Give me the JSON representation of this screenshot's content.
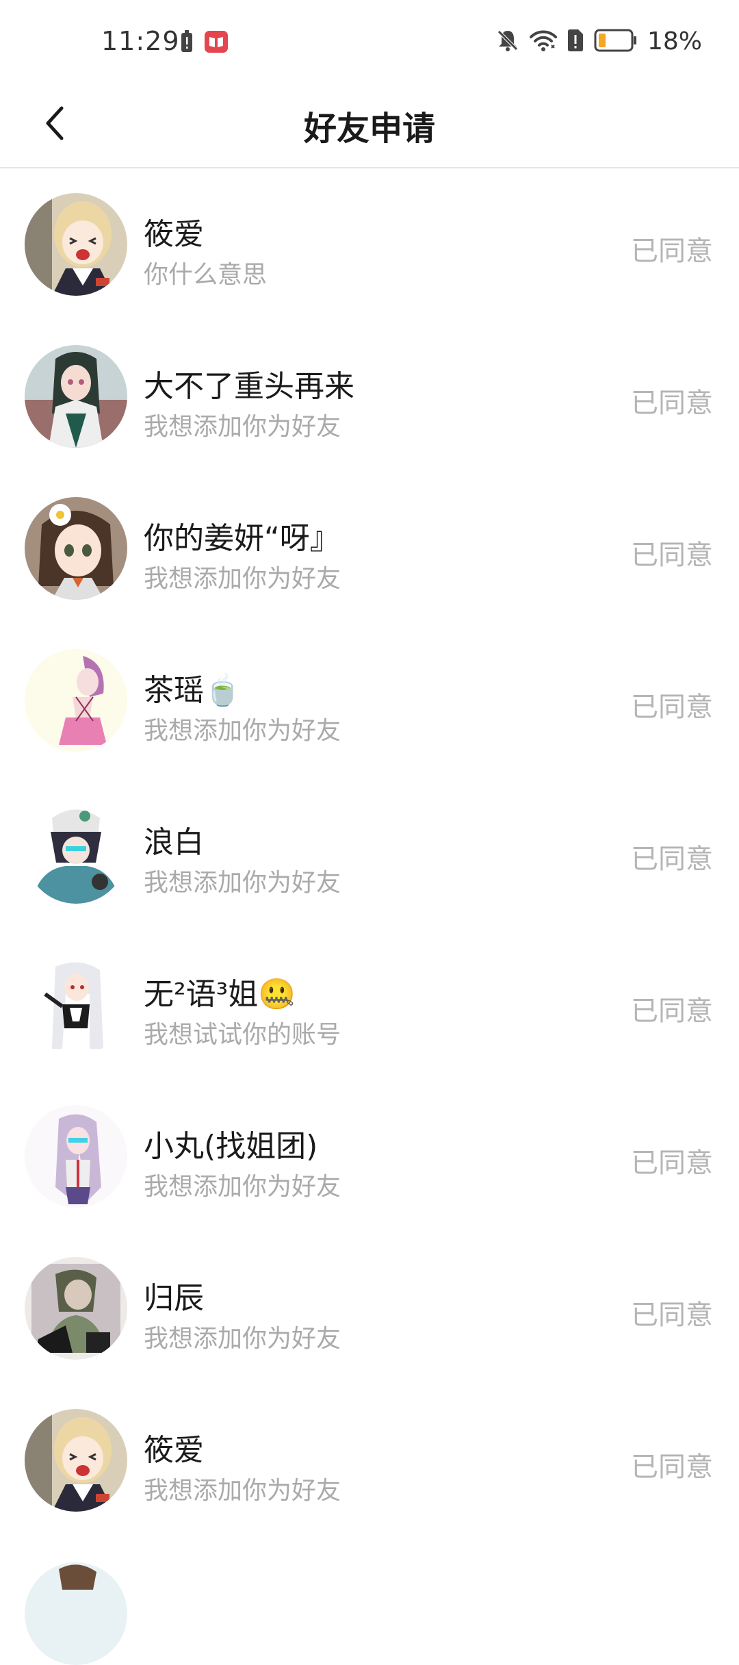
{
  "status_bar": {
    "time": "11:29",
    "battery_percent": "18%",
    "icons": [
      "battery-alert-icon",
      "app-notification-icon",
      "bell-muted-icon",
      "wifi-icon",
      "sim-alert-icon",
      "battery-icon"
    ]
  },
  "header": {
    "title": "好友申请"
  },
  "requests": [
    {
      "name": "筱爱",
      "message": "你什么意思",
      "status": "已同意"
    },
    {
      "name": "大不了重头再来",
      "message": "我想添加你为好友",
      "status": "已同意"
    },
    {
      "name": "你的姜妍“呀』",
      "message": "我想添加你为好友",
      "status": "已同意"
    },
    {
      "name": "茶瑶🍵",
      "message": "我想添加你为好友",
      "status": "已同意"
    },
    {
      "name": "浪白",
      "message": "我想添加你为好友",
      "status": "已同意"
    },
    {
      "name": "无²语³姐🤐",
      "message": "我想试试你的账号",
      "status": "已同意"
    },
    {
      "name": "小丸(找姐团)",
      "message": "我想添加你为好友",
      "status": "已同意"
    },
    {
      "name": "归辰",
      "message": "我想添加你为好友",
      "status": "已同意"
    },
    {
      "name": "筱爱",
      "message": "我想添加你为好友",
      "status": "已同意"
    }
  ],
  "colors": {
    "name_text": "#1a1a1a",
    "message_text": "#aaaaaa",
    "status_text": "#b5b5b5",
    "divider": "#e5e5e5",
    "battery_fill": "#f5a623"
  }
}
